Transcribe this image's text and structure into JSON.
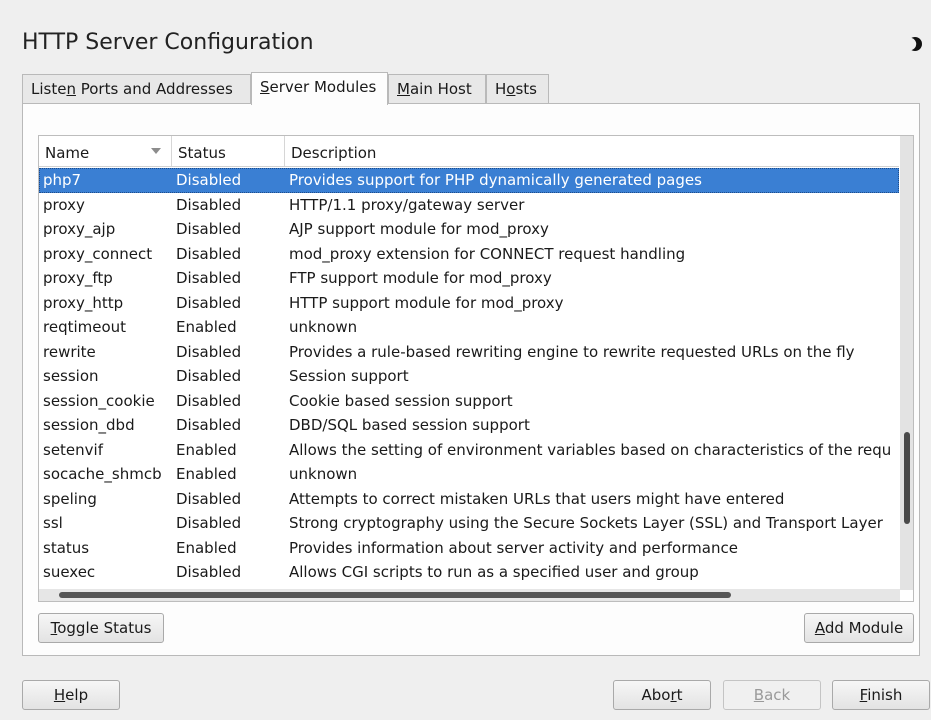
{
  "window": {
    "title": "HTTP Server Configuration"
  },
  "tabs": [
    {
      "label": "Listen Ports and Addresses"
    },
    {
      "label": "Server Modules",
      "active": true
    },
    {
      "label": "Main Host"
    },
    {
      "label": "Hosts"
    }
  ],
  "table": {
    "columns": [
      "Name",
      "Status",
      "Description"
    ],
    "sort_column": "Name",
    "rows": [
      {
        "name": "php7",
        "status": "Disabled",
        "description": "Provides support for PHP dynamically generated pages",
        "selected": true
      },
      {
        "name": "proxy",
        "status": "Disabled",
        "description": "HTTP/1.1 proxy/gateway server"
      },
      {
        "name": "proxy_ajp",
        "status": "Disabled",
        "description": "AJP support module for mod_proxy"
      },
      {
        "name": "proxy_connect",
        "status": "Disabled",
        "description": "mod_proxy extension for CONNECT request handling"
      },
      {
        "name": "proxy_ftp",
        "status": "Disabled",
        "description": "FTP support module for mod_proxy"
      },
      {
        "name": "proxy_http",
        "status": "Disabled",
        "description": "HTTP support module for mod_proxy"
      },
      {
        "name": "reqtimeout",
        "status": "Enabled",
        "description": "unknown"
      },
      {
        "name": "rewrite",
        "status": "Disabled",
        "description": "Provides a rule-based rewriting engine to rewrite requested URLs on the fly"
      },
      {
        "name": "session",
        "status": "Disabled",
        "description": "Session support"
      },
      {
        "name": "session_cookie",
        "status": "Disabled",
        "description": "Cookie based session support"
      },
      {
        "name": "session_dbd",
        "status": "Disabled",
        "description": "DBD/SQL based session support"
      },
      {
        "name": "setenvif",
        "status": "Enabled",
        "description": "Allows the setting of environment variables based on characteristics of the requ"
      },
      {
        "name": "socache_shmcb",
        "status": "Enabled",
        "description": "unknown"
      },
      {
        "name": "speling",
        "status": "Disabled",
        "description": "Attempts to correct mistaken URLs that users might have entered"
      },
      {
        "name": "ssl",
        "status": "Disabled",
        "description": "Strong cryptography using the Secure Sockets Layer (SSL) and Transport Layer"
      },
      {
        "name": "status",
        "status": "Enabled",
        "description": "Provides information about server activity and performance"
      },
      {
        "name": "suexec",
        "status": "Disabled",
        "description": "Allows CGI scripts to run as a specified user and group"
      }
    ]
  },
  "buttons": {
    "toggle_status": {
      "pre": "",
      "key": "T",
      "post": "oggle Status"
    },
    "add_module": {
      "pre": "",
      "key": "A",
      "post": "dd Module"
    },
    "help": {
      "pre": "",
      "key": "H",
      "post": "elp"
    },
    "abort": {
      "pre": "Abo",
      "key": "r",
      "post": "t"
    },
    "back": {
      "pre": "",
      "key": "B",
      "post": "ack"
    },
    "finish": {
      "pre": "",
      "key": "F",
      "post": "inish"
    }
  },
  "tab_labels": {
    "listen": {
      "pre": "Liste",
      "key": "n",
      "post": " Ports and Addresses"
    },
    "modules": {
      "pre": "",
      "key": "S",
      "post": "erver Modules"
    },
    "main": {
      "pre": "",
      "key": "M",
      "post": "ain Host"
    },
    "hosts": {
      "pre": "H",
      "key": "o",
      "post": "sts"
    }
  },
  "colors": {
    "selection": "#3a7fd3",
    "background": "#efefef"
  },
  "icons": {
    "theme_toggle": "half-moon-icon",
    "sort_indicator": "sort-down-icon"
  }
}
